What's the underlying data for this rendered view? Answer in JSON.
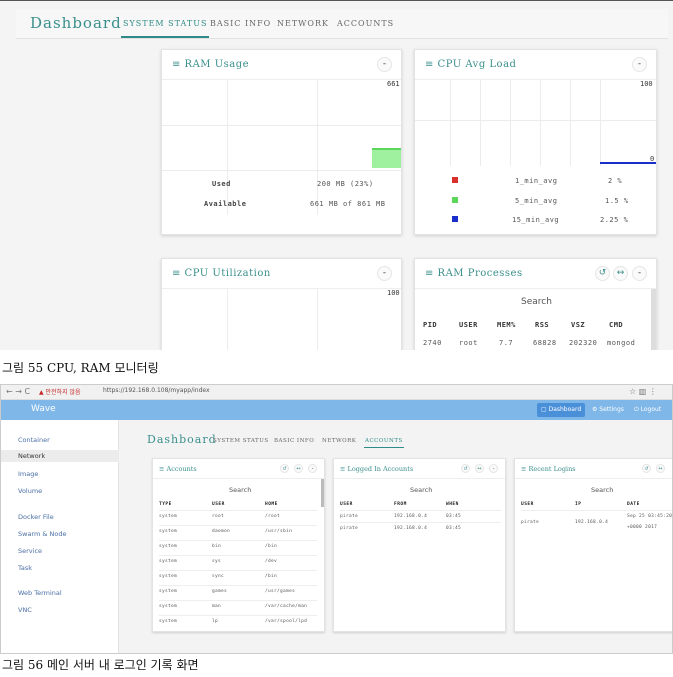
{
  "figure55": {
    "app_title": "Dashboard",
    "tabs": [
      "SYSTEM STATUS",
      "BASIC INFO",
      "NETWORK",
      "ACCOUNTS"
    ],
    "active_tab": "SYSTEM STATUS",
    "ram_usage": {
      "title": "≡ RAM Usage",
      "btn": "-",
      "y_max": "661",
      "y_min": "0",
      "rows": [
        {
          "label": "Used",
          "value": "200 MB (23%)"
        },
        {
          "label": "Available",
          "value": "661 MB of 861 MB"
        }
      ],
      "bar_fraction": 0.23
    },
    "cpu_avg_load": {
      "title": "≡ CPU Avg Load",
      "btn": "-",
      "y_max": "100",
      "y_min": "0",
      "legend": [
        {
          "name": "1_min_avg",
          "value": "2 %",
          "color": "#d9302e"
        },
        {
          "name": "5_min_avg",
          "value": "1.5 %",
          "color": "#5bd85b"
        },
        {
          "name": "15_min_avg",
          "value": "2.25 %",
          "color": "#1a2ecc"
        }
      ]
    },
    "cpu_utilization": {
      "title": "≡ CPU Utilization",
      "btn": "-",
      "y_max": "100"
    },
    "ram_processes": {
      "title": "≡ RAM Processes",
      "buttons": [
        "↺",
        "↔",
        "-"
      ],
      "search": "Search",
      "columns": [
        "PID",
        "USER",
        "MEM%",
        "RSS",
        "VSZ",
        "CMD"
      ],
      "row": [
        "2740",
        "root",
        "7.7",
        "68828",
        "202320",
        "mongod"
      ]
    }
  },
  "caption55": "그림 55 CPU, RAM 모니터링",
  "figure56": {
    "browser": {
      "nav": "← → C",
      "warn": "▲ 안전하지 않음",
      "url": "https://192.168.0.108/myapp/index",
      "right_icons": "☆ ▥ ⋮"
    },
    "app": {
      "brand": "Wave",
      "buttons": [
        "▢ Dashboard",
        "⚙ Settings",
        "⏻ Logout"
      ]
    },
    "sidebar": [
      "Container",
      "Network",
      "Image",
      "Volume",
      "Docker File",
      "Swarm & Node",
      "Service",
      "Task",
      "Web Terminal",
      "VNC"
    ],
    "active_sidebar": "Network",
    "dashboard_title": "Dashboard",
    "tabs": [
      "SYSTEM STATUS",
      "BASIC INFO",
      "NETWORK",
      "ACCOUNTS"
    ],
    "active_tab": "ACCOUNTS",
    "accounts": {
      "title": "≡ Accounts",
      "buttons": [
        "↺",
        "↔",
        "-"
      ],
      "search": "Search",
      "columns": [
        "TYPE",
        "USER",
        "HOME"
      ],
      "rows": [
        [
          "system",
          "root",
          "/root"
        ],
        [
          "system",
          "daemon",
          "/usr/sbin"
        ],
        [
          "system",
          "bin",
          "/bin"
        ],
        [
          "system",
          "sys",
          "/dev"
        ],
        [
          "system",
          "sync",
          "/bin"
        ],
        [
          "system",
          "games",
          "/usr/games"
        ],
        [
          "system",
          "man",
          "/var/cache/man"
        ],
        [
          "system",
          "lp",
          "/var/spool/lpd"
        ]
      ]
    },
    "logged_in": {
      "title": "≡ Logged In Accounts",
      "buttons": [
        "↺",
        "↔",
        "-"
      ],
      "search": "Search",
      "columns": [
        "USER",
        "FROM",
        "WHEN"
      ],
      "rows": [
        [
          "pirate",
          "192.168.0.4",
          "03:45"
        ],
        [
          "pirate",
          "192.168.0.4",
          "03:45"
        ]
      ]
    },
    "recent_logins": {
      "title": "≡ Recent Logins",
      "buttons": [
        "↺",
        "↔"
      ],
      "search": "Search",
      "columns": [
        "USER",
        "IP",
        "DATE"
      ],
      "row": [
        "pirate",
        "192.168.0.4",
        "Sep 25 03:45:20",
        "+0000 2017"
      ]
    }
  },
  "caption56": "그림 56 메인 서버 내 로그인 기록 화면"
}
